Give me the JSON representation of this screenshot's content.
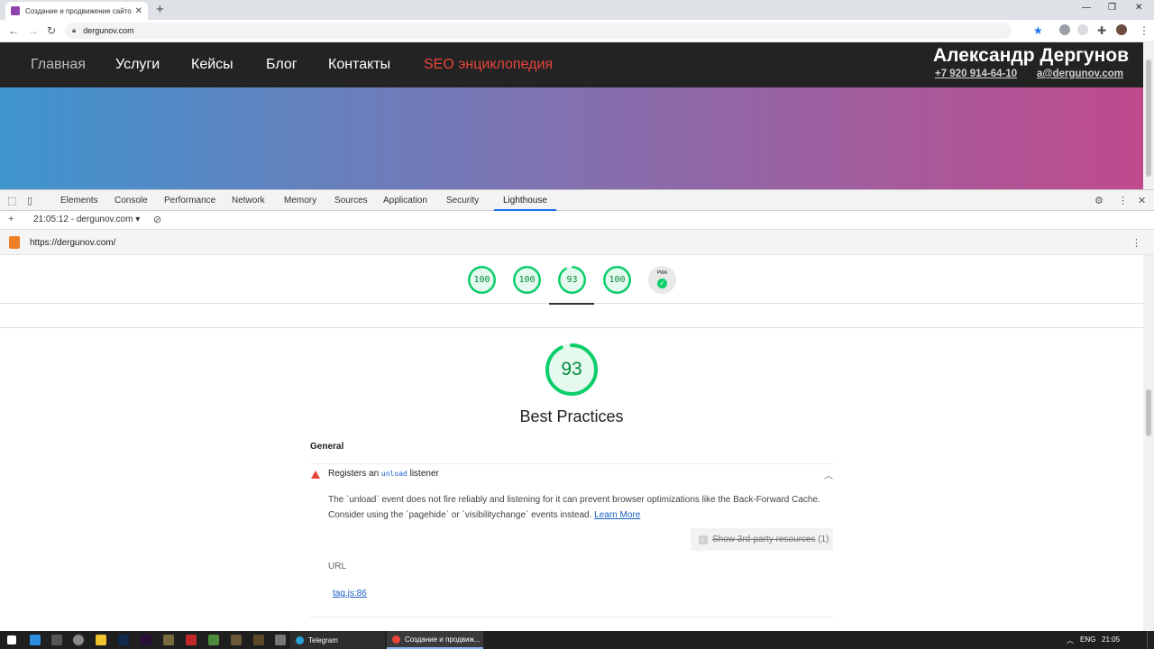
{
  "browser": {
    "tab_title": "Создание и продвижение сайтов",
    "tab_close": "✕",
    "new_tab": "+",
    "address": "dergunov.com",
    "window_controls": {
      "minimize": "—",
      "restore": "❐",
      "close": "✕"
    }
  },
  "site": {
    "nav": [
      {
        "label": "Главная",
        "color": "#bdbdbd"
      },
      {
        "label": "Услуги",
        "color": "#ffffff"
      },
      {
        "label": "Кейсы",
        "color": "#ffffff"
      },
      {
        "label": "Блог",
        "color": "#ffffff"
      },
      {
        "label": "Контакты",
        "color": "#ffffff"
      },
      {
        "label": "SEO энциклопедия",
        "color": "#e8453c"
      }
    ],
    "owner_name": "Александр Дергунов",
    "phone": "+7 920 914-64-10",
    "email": "a@dergunov.com"
  },
  "devtools": {
    "tabs": [
      "Elements",
      "Console",
      "Performance",
      "Network",
      "Memory",
      "Sources",
      "Application",
      "Security",
      "Lighthouse"
    ],
    "active_tab": "Lighthouse",
    "report_select": "21:05:12 - dergunov.com",
    "report_url": "https://dergunov.com/"
  },
  "lighthouse": {
    "summary_scores": [
      "100",
      "100",
      "93",
      "100"
    ],
    "pwa_label": "PWA",
    "category_score": "93",
    "category_score_value": 0.93,
    "category_title": "Best Practices",
    "group_title": "General",
    "audit": {
      "title_prefix": "Registers an",
      "title_code": "unload",
      "title_suffix": "listener",
      "description_line1": "The `unload` event does not fire reliably and listening for it can prevent browser optimizations like the Back-Forward Cache.",
      "description_line2": "Consider using the `pagehide` or `visibilitychange` events instead.",
      "learn_more": "Learn More",
      "third_party_label": "Show 3rd-party resources",
      "third_party_count": "(1)",
      "column_header": "URL",
      "url_item": "tag.js:86"
    },
    "colors": {
      "pass": "#0cce6b",
      "fail": "#e8453c"
    }
  },
  "taskbar": {
    "apps": [
      {
        "label": "Telegram",
        "color": "#2aa3d9"
      },
      {
        "label": "Создание и продвиж...",
        "color": "#e8453c"
      }
    ],
    "lang": "ENG",
    "time": "21:05"
  }
}
